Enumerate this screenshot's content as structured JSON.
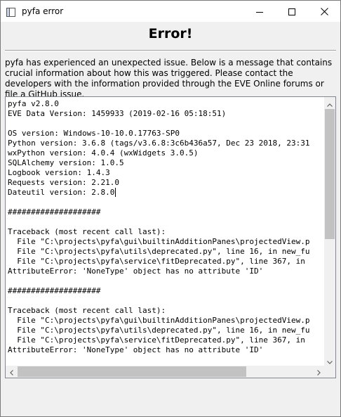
{
  "window": {
    "title": "pyfa error",
    "icons": {
      "app": "app-window-icon",
      "minimize": "minimize-icon",
      "maximize": "maximize-icon",
      "close": "close-icon"
    }
  },
  "heading": "Error!",
  "message": "pyfa has experienced an unexpected issue. Below is a message that contains crucial information about how this was triggered. Please contact the developers with the information provided through the EVE Online forums or file a GitHub issue.",
  "log": {
    "lines": [
      "pyfa v2.8.0",
      "EVE Data Version: 1459933 (2019-02-16 05:18:51)",
      "",
      "OS version: Windows-10-10.0.17763-SP0",
      "Python version: 3.6.8 (tags/v3.6.8:3c6b436a57, Dec 23 2018, 23:31",
      "wxPython version: 4.0.4 (wxWidgets 3.0.5)",
      "SQLAlchemy version: 1.0.5",
      "Logbook version: 1.4.3",
      "Requests version: 2.21.0",
      "Dateutil version: 2.8.0",
      "",
      "####################",
      "",
      "Traceback (most recent call last):",
      "  File \"C:\\projects\\pyfa\\gui\\builtinAdditionPanes\\projectedView.p",
      "  File \"C:\\projects\\pyfa\\utils\\deprecated.py\", line 16, in new_fu",
      "  File \"C:\\projects\\pyfa\\service\\fitDeprecated.py\", line 367, in",
      "AttributeError: 'NoneType' object has no attribute 'ID'",
      "",
      "####################",
      "",
      "Traceback (most recent call last):",
      "  File \"C:\\projects\\pyfa\\gui\\builtinAdditionPanes\\projectedView.p",
      "  File \"C:\\projects\\pyfa\\utils\\deprecated.py\", line 16, in new_fu",
      "  File \"C:\\projects\\pyfa\\service\\fitDeprecated.py\", line 367, in",
      "AttributeError: 'NoneType' object has no attribute 'ID'"
    ]
  },
  "scrollbars": {
    "vertical": {
      "position_fraction": 0.0
    },
    "horizontal": {
      "position_fraction": 0.0
    }
  },
  "colors": {
    "window_bg": "#f0f0f0",
    "text": "#000000",
    "scroll_thumb": "#c2c2c2"
  }
}
